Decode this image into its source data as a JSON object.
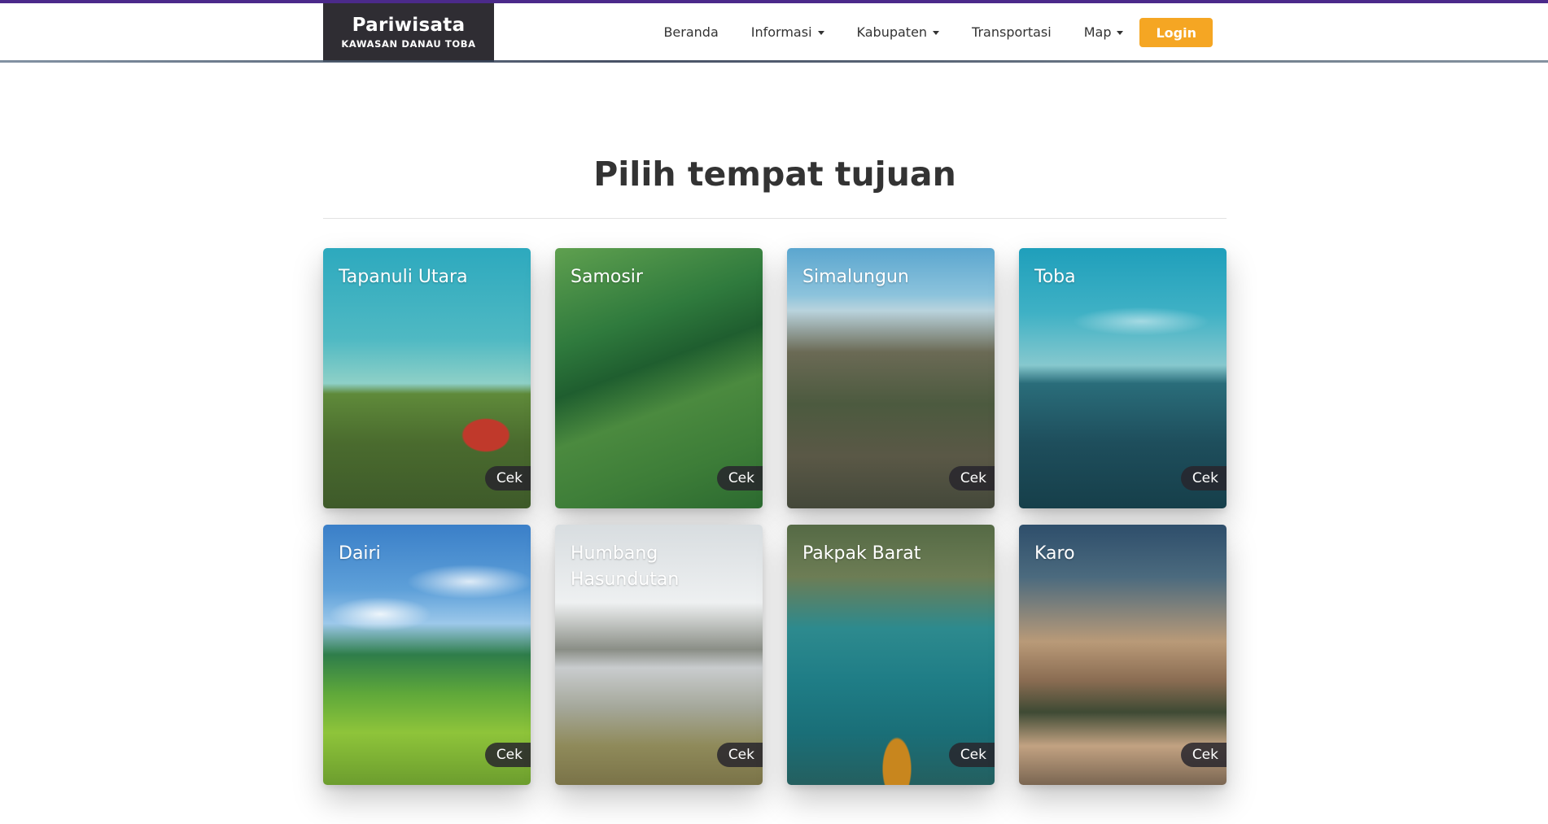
{
  "header": {
    "brand_title": "Pariwisata",
    "brand_subtitle": "KAWASAN DANAU TOBA",
    "nav": [
      {
        "label": "Beranda",
        "dropdown": false
      },
      {
        "label": "Informasi",
        "dropdown": true
      },
      {
        "label": "Kabupaten",
        "dropdown": true
      },
      {
        "label": "Transportasi",
        "dropdown": false
      },
      {
        "label": "Map",
        "dropdown": true
      }
    ],
    "login_label": "Login"
  },
  "main": {
    "title": "Pilih tempat tujuan",
    "cards": [
      {
        "name": "Tapanuli Utara",
        "button": "Cek"
      },
      {
        "name": "Samosir",
        "button": "Cek"
      },
      {
        "name": "Simalungun",
        "button": "Cek"
      },
      {
        "name": "Toba",
        "button": "Cek"
      },
      {
        "name": "Dairi",
        "button": "Cek"
      },
      {
        "name": "Humbang Hasundutan",
        "button": "Cek"
      },
      {
        "name": "Pakpak Barat",
        "button": "Cek"
      },
      {
        "name": "Karo",
        "button": "Cek"
      }
    ]
  },
  "colors": {
    "accent": "#f5a623",
    "brand_bg": "#2f2d33",
    "top_line": "#4b2a8a"
  }
}
